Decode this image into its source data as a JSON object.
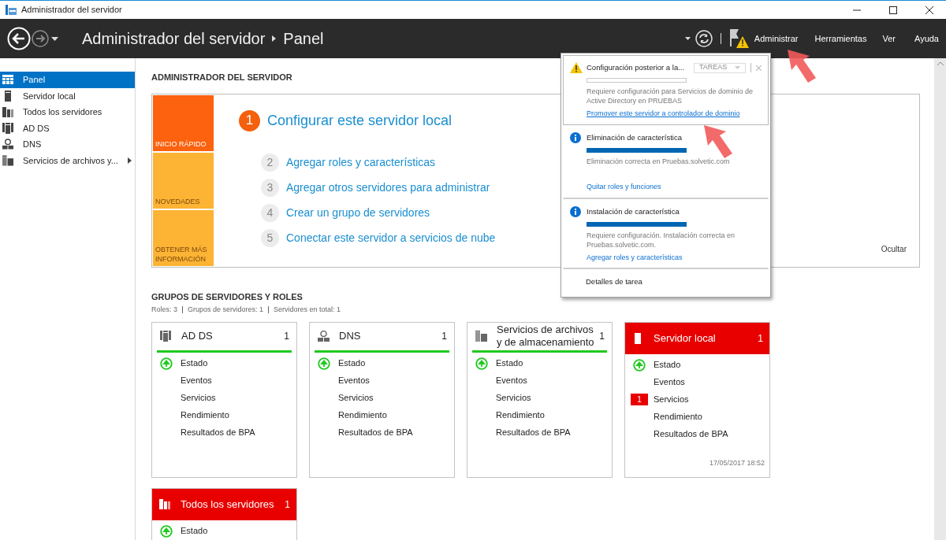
{
  "window": {
    "title": "Administrador del servidor"
  },
  "header": {
    "breadcrumb": [
      "Administrador del servidor",
      "Panel"
    ],
    "menu": [
      "Administrar",
      "Herramientas",
      "Ver",
      "Ayuda"
    ],
    "notification_warning": true
  },
  "sidebar": {
    "items": [
      {
        "label": "Panel",
        "kind": "dashboard",
        "selected": true,
        "expandable": false
      },
      {
        "label": "Servidor local",
        "kind": "server",
        "selected": false,
        "expandable": false
      },
      {
        "label": "Todos los servidores",
        "kind": "servers",
        "selected": false,
        "expandable": false
      },
      {
        "label": "AD DS",
        "kind": "ad",
        "selected": false,
        "expandable": false
      },
      {
        "label": "DNS",
        "kind": "dns",
        "selected": false,
        "expandable": false
      },
      {
        "label": "Servicios de archivos y...",
        "kind": "files",
        "selected": false,
        "expandable": true
      }
    ]
  },
  "welcome": {
    "heading": "ADMINISTRADOR DEL SERVIDOR",
    "tiles": [
      {
        "label": "INICIO RÁPIDO",
        "selected": true
      },
      {
        "label": "NOVEDADES",
        "selected": false
      },
      {
        "label": "OBTENER MÁS INFORMACIÓN",
        "selected": false
      }
    ],
    "steps": [
      {
        "number": "1",
        "label": "Configurar este servidor local",
        "primary": true
      },
      {
        "number": "2",
        "label": "Agregar roles y características",
        "primary": false
      },
      {
        "number": "3",
        "label": "Agregar otros servidores para administrar",
        "primary": false
      },
      {
        "number": "4",
        "label": "Crear un grupo de servidores",
        "primary": false
      },
      {
        "number": "5",
        "label": "Conectar este servidor a servicios de nube",
        "primary": false
      }
    ],
    "hide": "Ocultar"
  },
  "groups": {
    "heading": "GRUPOS DE SERVIDORES Y ROLES",
    "summary": [
      "Roles: 3",
      "Grupos de servidores: 1",
      "Servidores en total: 1"
    ],
    "tiles": [
      {
        "title": "AD DS",
        "kind": "ad",
        "count": "1",
        "alert": false,
        "rows": [
          {
            "label": "Estado",
            "healthy": true
          },
          {
            "label": "Eventos"
          },
          {
            "label": "Servicios"
          },
          {
            "label": "Rendimiento"
          },
          {
            "label": "Resultados de BPA"
          }
        ]
      },
      {
        "title": "DNS",
        "kind": "dns",
        "count": "1",
        "alert": false,
        "rows": [
          {
            "label": "Estado",
            "healthy": true
          },
          {
            "label": "Eventos"
          },
          {
            "label": "Servicios"
          },
          {
            "label": "Rendimiento"
          },
          {
            "label": "Resultados de BPA"
          }
        ]
      },
      {
        "title": "Servicios de archivos y de almacenamiento",
        "kind": "files",
        "count": "1",
        "alert": false,
        "rows": [
          {
            "label": "Estado",
            "healthy": true
          },
          {
            "label": "Eventos"
          },
          {
            "label": "Servicios"
          },
          {
            "label": "Rendimiento"
          },
          {
            "label": "Resultados de BPA"
          }
        ]
      },
      {
        "title": "Servidor local",
        "kind": "server",
        "count": "1",
        "alert": true,
        "rows": [
          {
            "label": "Estado",
            "healthy": true
          },
          {
            "label": "Eventos"
          },
          {
            "label": "Servicios",
            "badge": "1"
          },
          {
            "label": "Rendimiento"
          },
          {
            "label": "Resultados de BPA"
          }
        ],
        "timestamp": "17/05/2017 18:52"
      },
      {
        "title": "Todos los servidores",
        "kind": "servers",
        "count": "1",
        "alert": true,
        "rows": [
          {
            "label": "Estado",
            "healthy": true
          }
        ]
      }
    ]
  },
  "notifications": {
    "items": [
      {
        "kind": "warning",
        "title": "Configuración posterior a la...",
        "level": 0,
        "tasks": "TAREAS",
        "selected": true,
        "description": "Requiere configuración para Servicios de dominio de Active Directory en PRUEBAS",
        "link": "Promover este servidor a controlador de dominio"
      },
      {
        "kind": "info",
        "title": "Eliminación de característica",
        "level": 1,
        "selected": false,
        "description": "Eliminación correcta en Pruebas.solvetic.com",
        "link": "Quitar roles y funciones"
      },
      {
        "kind": "info",
        "title": "Instalación de característica",
        "level": 1,
        "selected": false,
        "description": "Requiere configuración. Instalación correcta en Pruebas.solvetic.com.",
        "link": "Agregar roles y características"
      }
    ],
    "footer": "Detalles de tarea"
  }
}
